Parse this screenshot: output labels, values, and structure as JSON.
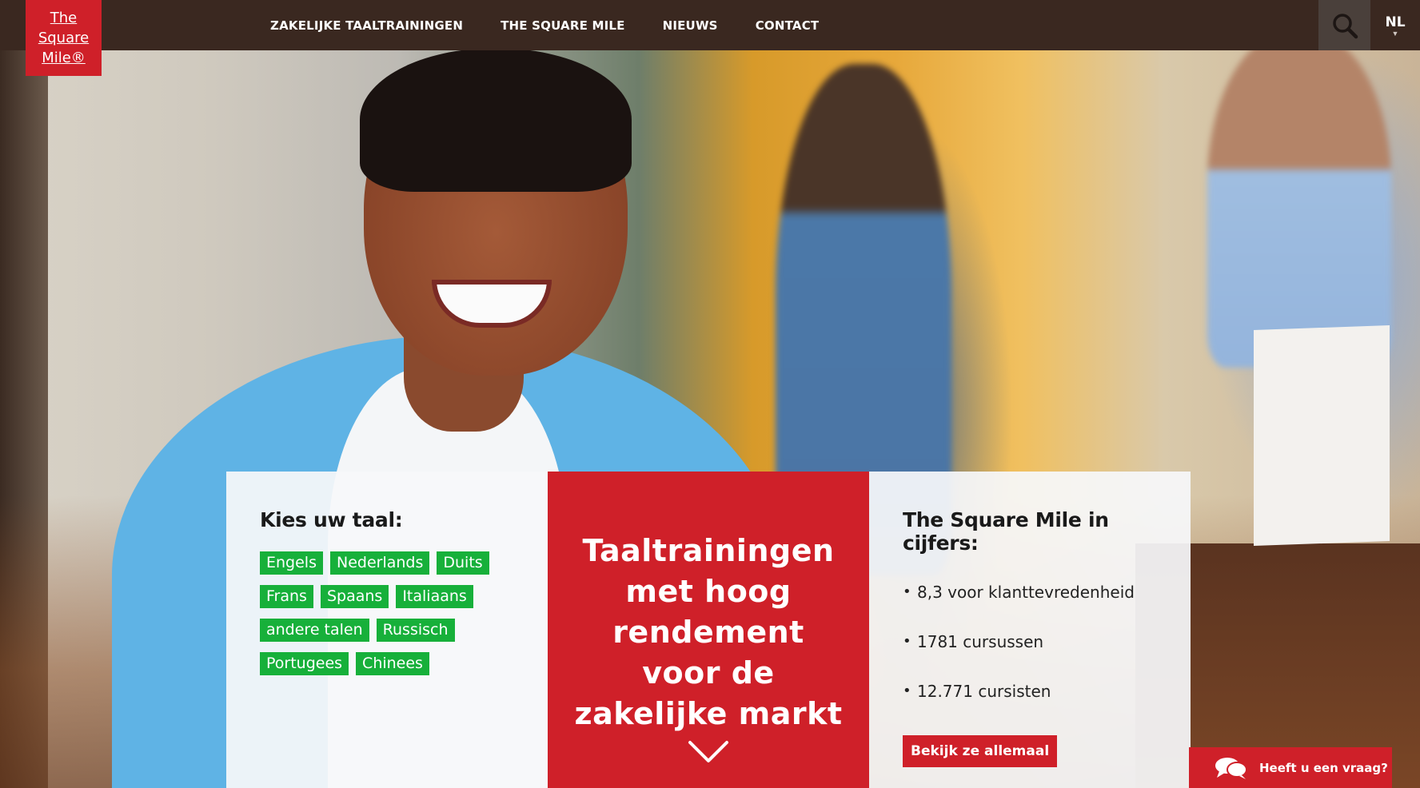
{
  "brand": {
    "logo_text": "The\nSquare\nMile®",
    "red": "#cf2029",
    "green": "#17b03a",
    "topbar": "#3a2820"
  },
  "nav": {
    "items": [
      {
        "label": "ZAKELIJKE TAALTRAININGEN"
      },
      {
        "label": "THE SQUARE MILE"
      },
      {
        "label": "NIEUWS"
      },
      {
        "label": "CONTACT"
      }
    ],
    "search_icon": "search-icon",
    "language": "NL"
  },
  "languages": {
    "title": "Kies uw taal:",
    "tags": [
      "Engels",
      "Nederlands",
      "Duits",
      "Frans",
      "Spaans",
      "Italiaans",
      "andere talen",
      "Russisch",
      "Portugees",
      "Chinees"
    ]
  },
  "headline": {
    "text": "Taaltrainingen met hoog rendement voor de zakelijke markt",
    "arrow_icon": "chevron-down-icon"
  },
  "stats": {
    "title": "The Square Mile in cijfers:",
    "items": [
      "8,3 voor klanttevredenheid",
      "1781 cursussen",
      "12.771 cursisten"
    ],
    "button": "Bekijk ze allemaal"
  },
  "chat": {
    "label": "Heeft u een vraag?",
    "icon": "chat-bubbles-icon"
  }
}
